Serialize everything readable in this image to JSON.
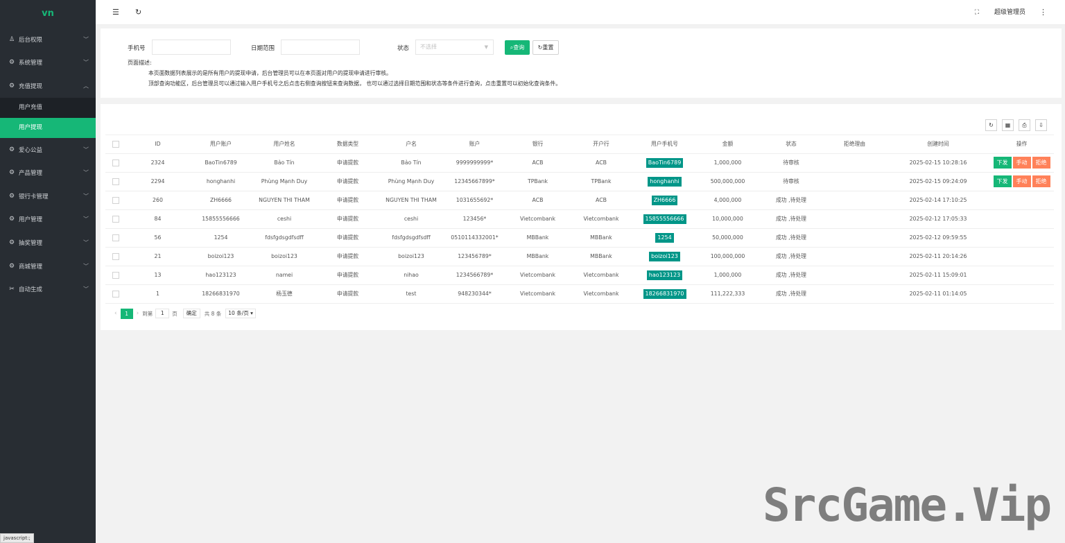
{
  "logo": "vn",
  "sidebar": {
    "items": [
      {
        "label": "后台权限",
        "icon": "user-icon",
        "expanded": false
      },
      {
        "label": "系统管理",
        "icon": "gear-icon",
        "expanded": false
      },
      {
        "label": "充值提现",
        "icon": "gear-icon",
        "expanded": true,
        "children": [
          {
            "label": "用户充值",
            "active": false
          },
          {
            "label": "用户提现",
            "active": true
          }
        ]
      },
      {
        "label": "爱心公益",
        "icon": "gear-icon",
        "expanded": false
      },
      {
        "label": "产品管理",
        "icon": "gear-icon",
        "expanded": false
      },
      {
        "label": "银行卡管理",
        "icon": "gear-icon",
        "expanded": false
      },
      {
        "label": "用户管理",
        "icon": "gear-icon",
        "expanded": false
      },
      {
        "label": "抽奖管理",
        "icon": "gear-icon",
        "expanded": false
      },
      {
        "label": "商城管理",
        "icon": "gear-icon",
        "expanded": false
      },
      {
        "label": "自动生成",
        "icon": "scissors-icon",
        "expanded": false
      }
    ]
  },
  "status_tip": "javascript:;",
  "header": {
    "admin_name": "超级管理员"
  },
  "search": {
    "phone_label": "手机号",
    "date_label": "日期范围",
    "status_label": "状态",
    "status_placeholder": "不选择",
    "query_btn": "查询",
    "reset_btn": "重置",
    "desc_title": "页面描述:",
    "desc_line1": "本页面数据列表展示的是所有用户的提现申请，后台管理员可以在本页面对用户的提现申请进行审核。",
    "desc_line2": "顶部查询功能区，后台管理员可以通过输入用户手机号之后点击右侧查询按钮来查询数据，  也可以通过选择日期范围和状态等条件进行查询，点击重置可以初始化查询条件。"
  },
  "table": {
    "columns": [
      "ID",
      "用户账户",
      "用户姓名",
      "数据类型",
      "户名",
      "账户",
      "银行",
      "开户行",
      "用户手机号",
      "金额",
      "状态",
      "拒绝理由",
      "创建时间",
      "操作"
    ],
    "rows": [
      {
        "id": "2324",
        "account": "BaoTin6789",
        "name": "Bảo Tín",
        "type": "申请提款",
        "holder": "Bảo Tín",
        "acct_no": "9999999999*",
        "bank": "ACB",
        "branch": "ACB",
        "phone": "BaoTin6789",
        "amount": "1,000,000",
        "status": "待审核",
        "reason": "",
        "created": "2025-02-15 10:28:16",
        "actions": true
      },
      {
        "id": "2294",
        "account": "honghanhi",
        "name": "Phùng Mạnh Duy",
        "type": "申请提款",
        "holder": "Phùng Mạnh Duy",
        "acct_no": "12345667899*",
        "bank": "TPBank",
        "branch": "TPBank",
        "phone": "honghanhi",
        "amount": "500,000,000",
        "status": "待审核",
        "reason": "",
        "created": "2025-02-15 09:24:09",
        "actions": true
      },
      {
        "id": "260",
        "account": "ZH6666",
        "name": "NGUYEN THI THAM",
        "type": "申请提款",
        "holder": "NGUYEN THI THAM",
        "acct_no": "1031655692*",
        "bank": "ACB",
        "branch": "ACB",
        "phone": "ZH6666",
        "amount": "4,000,000",
        "status": "成功 ,待处理",
        "reason": "",
        "created": "2025-02-14 17:10:25",
        "actions": false
      },
      {
        "id": "84",
        "account": "15855556666",
        "name": "ceshi",
        "type": "申请提款",
        "holder": "ceshi",
        "acct_no": "123456*",
        "bank": "Vietcombank",
        "branch": "Vietcombank",
        "phone": "15855556666",
        "amount": "10,000,000",
        "status": "成功 ,待处理",
        "reason": "",
        "created": "2025-02-12 17:05:33",
        "actions": false
      },
      {
        "id": "56",
        "account": "1254",
        "name": "fdsfgdsgdfsdff",
        "type": "申请提款",
        "holder": "fdsfgdsgdfsdff",
        "acct_no": "0510114332001*",
        "bank": "MBBank",
        "branch": "MBBank",
        "phone": "1254",
        "amount": "50,000,000",
        "status": "成功 ,待处理",
        "reason": "",
        "created": "2025-02-12 09:59:55",
        "actions": false
      },
      {
        "id": "21",
        "account": "boizoi123",
        "name": "boizoi123",
        "type": "申请提款",
        "holder": "boizoi123",
        "acct_no": "123456789*",
        "bank": "MBBank",
        "branch": "MBBank",
        "phone": "boizoi123",
        "amount": "100,000,000",
        "status": "成功 ,待处理",
        "reason": "",
        "created": "2025-02-11 20:14:26",
        "actions": false
      },
      {
        "id": "13",
        "account": "hao123123",
        "name": "namei",
        "type": "申请提款",
        "holder": "nihao",
        "acct_no": "1234566789*",
        "bank": "Vietcombank",
        "branch": "Vietcombank",
        "phone": "hao123123",
        "amount": "1,000,000",
        "status": "成功 ,待处理",
        "reason": "",
        "created": "2025-02-11 15:09:01",
        "actions": false
      },
      {
        "id": "1",
        "account": "18266831970",
        "name": "杨玉德",
        "type": "申请提款",
        "holder": "test",
        "acct_no": "948230344*",
        "bank": "Vietcombank",
        "branch": "Vietcombank",
        "phone": "18266831970",
        "amount": "111,222,333",
        "status": "成功 ,待处理",
        "reason": "",
        "created": "2025-02-11 01:14:05",
        "actions": false
      }
    ],
    "action_labels": {
      "payout": "下发",
      "manual": "手动",
      "reject": "拒绝"
    }
  },
  "pager": {
    "current": "1",
    "goto_label": "到第",
    "goto_value": "1",
    "page_unit": "页",
    "confirm": "确定",
    "total": "共 8 条",
    "page_size": "10 条/页"
  },
  "watermark": "SrcGame.Vip"
}
